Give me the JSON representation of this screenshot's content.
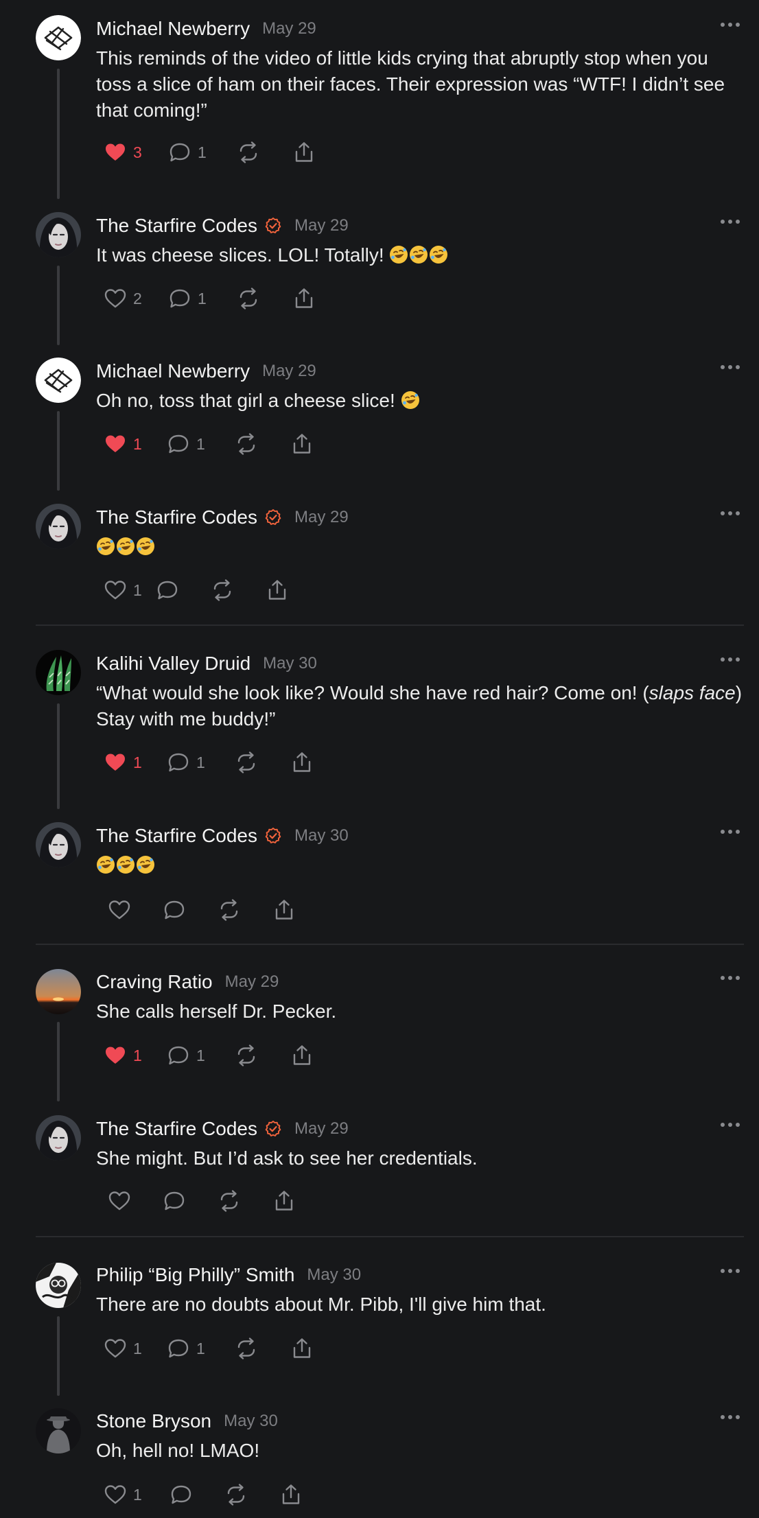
{
  "colors": {
    "background": "#17181a",
    "like": "#f04a55",
    "verified": "#f0633c",
    "muted": "#7d7e82"
  },
  "icons": [
    "heart-icon",
    "comment-icon",
    "repost-icon",
    "share-icon",
    "more-icon",
    "verified-icon",
    "rofl-emoji"
  ],
  "posts": [
    {
      "author": "Michael Newberry",
      "date": "May 29",
      "text": "This reminds of the video of little kids crying that abruptly stop when you toss a slice of ham on their faces. Their expression was “WTF! I didn’t see that coming!”",
      "likes": "3",
      "comments": "1",
      "liked": true
    },
    {
      "author": "The Starfire Codes",
      "date": "May 29",
      "text": "It was cheese slices. LOL! Totally! ",
      "likes": "2",
      "comments": "1",
      "liked": false,
      "verified": true
    },
    {
      "author": "Michael Newberry",
      "date": "May 29",
      "text": "Oh no, toss that girl a cheese slice! ",
      "likes": "1",
      "comments": "1",
      "liked": true
    },
    {
      "author": "The Starfire Codes",
      "date": "May 29",
      "text": "",
      "likes": "1",
      "comments": "",
      "liked": false,
      "verified": true
    },
    {
      "author": "Kalihi Valley Druid",
      "date": "May 30",
      "text_before": "“What would she look like? Would she have red hair? Come on! (",
      "text_italic": "slaps face",
      "text_after": ") Stay with me buddy!”",
      "likes": "1",
      "comments": "1",
      "liked": true
    },
    {
      "author": "The Starfire Codes",
      "date": "May 30",
      "text": "",
      "likes": "",
      "comments": "",
      "liked": false,
      "verified": true
    },
    {
      "author": "Craving Ratio",
      "date": "May 29",
      "text": "She calls herself Dr. Pecker.",
      "likes": "1",
      "comments": "1",
      "liked": true
    },
    {
      "author": "The Starfire Codes",
      "date": "May 29",
      "text": "She might. But I’d ask to see her credentials.",
      "likes": "",
      "comments": "",
      "liked": false,
      "verified": true
    },
    {
      "author": "Philip “Big Philly” Smith",
      "date": "May 30",
      "text": "There are no doubts about Mr. Pibb, I'll give him that.",
      "likes": "1",
      "comments": "1",
      "liked": false
    },
    {
      "author": "Stone Bryson",
      "date": "May 30",
      "text": "Oh, hell no! LMAO!",
      "likes": "1",
      "comments": "",
      "liked": false
    }
  ]
}
